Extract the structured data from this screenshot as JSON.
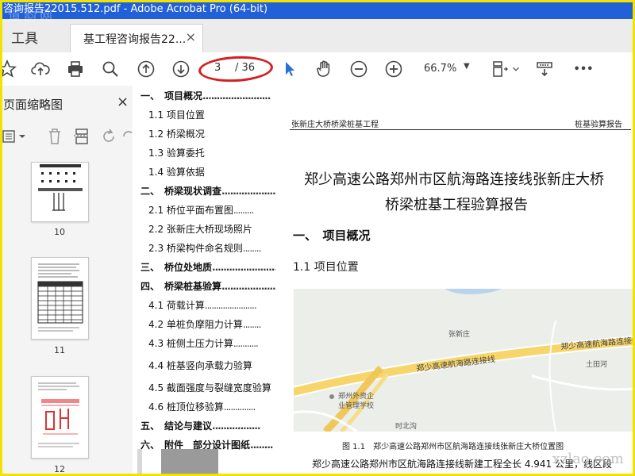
{
  "window": {
    "title": "咨询报告22015.512.pdf - Adobe Acrobat Pro (64-bit)"
  },
  "watermarks": {
    "top_left": "道韵网",
    "bottom_right": "xzlao.com"
  },
  "tabs": {
    "tools": "工具",
    "document": "基工程咨询报告22...",
    "close": "×"
  },
  "toolbar": {
    "icons": [
      "star-icon",
      "upload-icon",
      "print-icon",
      "search-icon",
      "page-up-icon",
      "page-down-icon",
      "select-arrow-icon",
      "hand-icon",
      "zoom-out-icon",
      "zoom-in-icon",
      "page-fit-icon",
      "comment-icon",
      "more-icon"
    ],
    "page_current": "3",
    "page_total": "/ 36",
    "zoom": "66.7%",
    "more": "•••"
  },
  "left_panel": {
    "title": "页面缩略图",
    "close": "×",
    "thumbnails": [
      {
        "number": "10"
      },
      {
        "number": "11"
      },
      {
        "number": "12"
      }
    ]
  },
  "bookmarks": [
    {
      "label": "一、　项目概况",
      "level": 1
    },
    {
      "label": "1.1 项目位置",
      "level": 2
    },
    {
      "label": "1.2 桥梁概况",
      "level": 2
    },
    {
      "label": "1.3 验算委托",
      "level": 2
    },
    {
      "label": "1.4 验算依据",
      "level": 2
    },
    {
      "label": "二、　桥梁现状调查",
      "level": 1
    },
    {
      "label": "2.1 桥位平面布置图",
      "level": 2
    },
    {
      "label": "2.2 张新庄大桥现场照片",
      "level": 2
    },
    {
      "label": "2.3 桥梁构件命名规则",
      "level": 2
    },
    {
      "label": "三、　桥位处地质",
      "level": 1
    },
    {
      "label": "四、　桥梁桩基验算",
      "level": 1
    },
    {
      "label": "4.1 荷载计算",
      "level": 2
    },
    {
      "label": "4.2 单桩负摩阻力计算",
      "level": 2
    },
    {
      "label": "4.3 桩侧土压力计算",
      "level": 2
    },
    {
      "label": "4.4 桩基竖向承载力验算",
      "level": 2
    },
    {
      "label": "4.5 截面强度与裂缝宽度验算",
      "level": 2
    },
    {
      "label": "4.6 桩顶位移验算",
      "level": 2
    },
    {
      "label": "五、　结论与建议",
      "level": 1
    },
    {
      "label": "六、　附件　部分设计图纸",
      "level": 1
    }
  ],
  "document": {
    "header_left": "张新庄大桥桥梁桩基工程",
    "header_right": "桩基验算报告",
    "title_line1": "郑少高速公路郑州市区航海路连接线张新庄大桥",
    "title_line2": "桥梁桩基工程验算报告",
    "section1": "一、　项目概况",
    "section11": "1.1 项目位置",
    "map_labels": [
      "张新庄",
      "郑少高速航海路连接线",
      "郑少高速航海路连接线",
      "土田河",
      "郑州外资企业管理学校",
      "时北沟"
    ],
    "caption": "图 1.1　郑少高速公路郑州市区航海路连接线张新庄大桥位置图",
    "body": "郑少高速公路郑州市区航海路连接线新建工程全长 4.941 公里，线区段"
  }
}
